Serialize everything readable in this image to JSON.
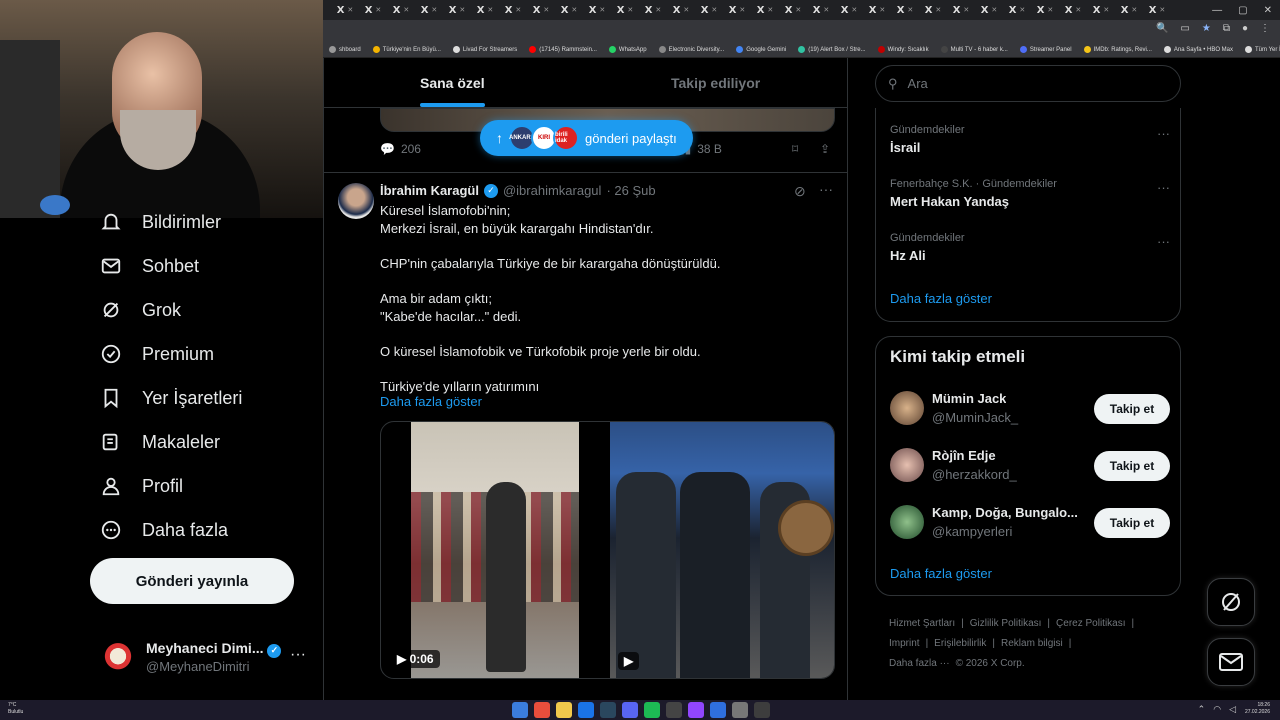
{
  "browser": {
    "tab_glyph": "X",
    "tab_count": 30,
    "bookmarks": [
      {
        "label": "shboard",
        "color": "#999999"
      },
      {
        "label": "Türkiye'nin En Büyü...",
        "color": "#f4b400"
      },
      {
        "label": "Livad For Streamers",
        "color": "#dddddd"
      },
      {
        "label": "(17145) Rammstein...",
        "color": "#ff0000"
      },
      {
        "label": "WhatsApp",
        "color": "#25d366"
      },
      {
        "label": "Electronic Diversity...",
        "color": "#888888"
      },
      {
        "label": "Google Gemini",
        "color": "#4285f4"
      },
      {
        "label": "(19) Alert Box / Stre...",
        "color": "#31c3a2"
      },
      {
        "label": "Windy: Sıcaklık",
        "color": "#c00000"
      },
      {
        "label": "Multi TV - 6 haber k...",
        "color": "#444444"
      },
      {
        "label": "Streamer Panel",
        "color": "#4f6ef7"
      },
      {
        "label": "IMDb: Ratings, Revi...",
        "color": "#f5c518"
      },
      {
        "label": "Ana Sayfa • HBO Max",
        "color": "#dddddd"
      },
      {
        "label": "Tüm Yer İşaretleri",
        "color": "#dddddd"
      }
    ]
  },
  "sidebar": {
    "items": [
      {
        "label": "Bildirimler",
        "icon": "bell-icon"
      },
      {
        "label": "Sohbet",
        "icon": "mail-icon"
      },
      {
        "label": "Grok",
        "icon": "grok-icon"
      },
      {
        "label": "Premium",
        "icon": "premium-icon"
      },
      {
        "label": "Yer İşaretleri",
        "icon": "bookmark-icon"
      },
      {
        "label": "Makaleler",
        "icon": "article-icon"
      },
      {
        "label": "Profil",
        "icon": "profile-icon"
      },
      {
        "label": "Daha fazla",
        "icon": "more-circle-icon"
      }
    ],
    "post_button": "Gönderi yayınla",
    "account": {
      "name": "Meyhaneci Dimi...",
      "handle": "@MeyhaneDimitri",
      "more": "···"
    }
  },
  "feed": {
    "tabs": [
      "Sana özel",
      "Takip ediliyor"
    ],
    "new_posts_pill": "gönderi paylaştı",
    "pill_avatars": [
      "ANKARA",
      "KIRI",
      "birili idak"
    ],
    "prev_tweet": {
      "replies": "206",
      "views": "38 B"
    },
    "tweet": {
      "name": "İbrahim Karagül",
      "handle": "@ibrahimkaragul",
      "date": "· 26 Şub",
      "lines": [
        "Küresel İslamofobi'nin;",
        "Merkezi İsrail, en büyük karargahı Hindistan'dır.",
        "",
        "CHP'nin çabalarıyla Türkiye de bir karargaha dönüştürüldü.",
        "",
        "Ama bir adam çıktı;",
        "\"Kabe'de hacılar...\" dedi.",
        "",
        "O küresel İslamofobik ve Türkofobik proje yerle bir oldu.",
        "",
        "Türkiye'de yılların yatırımını"
      ],
      "show_more": "Daha fazla göster",
      "video1_time": "0:06"
    }
  },
  "right": {
    "search_placeholder": "Ara",
    "trends": [
      {
        "context": "Gündemdekiler",
        "title": "İsrail"
      },
      {
        "context": "Fenerbahçe S.K. · Gündemdekiler",
        "title": "Mert Hakan Yandaş"
      },
      {
        "context": "Gündemdekiler",
        "title": "Hz Ali"
      }
    ],
    "trends_show_more": "Daha fazla göster",
    "who_to_follow_title": "Kimi takip etmeli",
    "who_to_follow": [
      {
        "name": "Mümin Jack",
        "handle": "@MuminJack_",
        "button": "Takip et",
        "color": "#8a6a4a"
      },
      {
        "name": "Ròjîn Edje",
        "handle": "@herzakkord_",
        "button": "Takip et",
        "color": "#b98a8a"
      },
      {
        "name": "Kamp, Doğa, Bungalo...",
        "handle": "@kampyerleri",
        "button": "Takip et",
        "color": "#2f6b3a"
      }
    ],
    "wtf_show_more": "Daha fazla göster",
    "footer": [
      "Hizmet Şartları",
      "|",
      "Gizlilik Politikası",
      "|",
      "Çerez Politikası",
      "|",
      "Imprint",
      "|",
      "Erişilebilirlik",
      "|",
      "Reklam bilgisi",
      "|",
      "Daha fazla ···",
      "© 2026 X Corp."
    ]
  },
  "taskbar": {
    "weather_temp": "7°C",
    "weather_desc": "Bulutlu",
    "time": "18:26",
    "date": "27.02.2026"
  }
}
